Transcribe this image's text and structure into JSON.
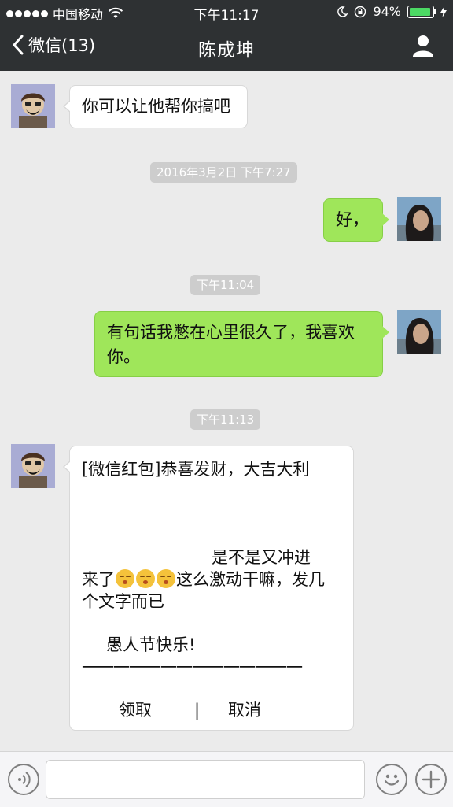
{
  "status_bar": {
    "carrier": "中国移动",
    "time": "下午11:17",
    "battery": "94%",
    "battery_level": 0.94
  },
  "nav": {
    "back_label": "微信(13)",
    "title": "陈成坤"
  },
  "messages": [
    {
      "text": "你可以让他帮你搞吧"
    },
    {
      "timestamp": "2016年3月2日 下午7:27"
    },
    {
      "text": "好，"
    },
    {
      "timestamp": "下午11:04"
    },
    {
      "text_line1": "有句话我憋在心里很久了，我喜欢",
      "text_line2": "你。"
    },
    {
      "timestamp": "下午11:13"
    },
    {
      "line1": "[微信红包]恭喜发财，大吉大利",
      "line2": "是不是又冲进",
      "line3a": "来了",
      "line3b": "这么激动干嘛，发几",
      "line4": "个文字而已",
      "line5": "愚人节快乐!",
      "dashes": "一一一一一一一一一一一一一一",
      "action_accept": "领取",
      "separator": "|",
      "action_cancel": "取消"
    }
  ],
  "icons": [
    "back-chevron-icon",
    "profile-icon",
    "voice-icon",
    "emoji-icon",
    "plus-icon",
    "wifi-icon",
    "moon-icon",
    "lock-rotation-icon",
    "charging-icon"
  ]
}
